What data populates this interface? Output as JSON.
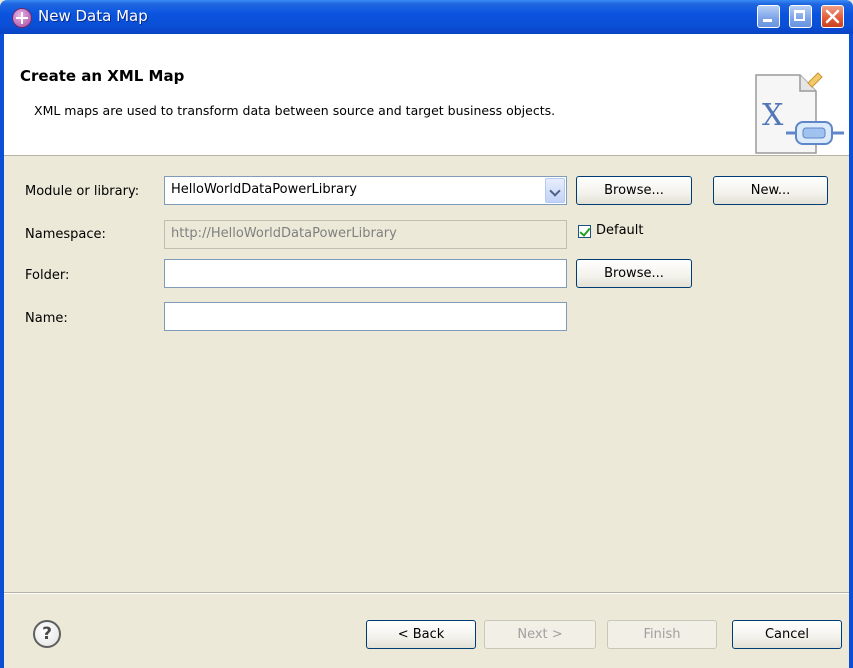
{
  "window": {
    "title": "New Data Map"
  },
  "header": {
    "title": "Create an XML Map",
    "description": "XML maps are used to transform data between source and target business objects.",
    "graphic_letter": "X"
  },
  "form": {
    "module_label": "Module or library:",
    "module_value": "HelloWorldDataPowerLibrary",
    "module_browse_label": "Browse...",
    "module_new_label": "New...",
    "namespace_label": "Namespace:",
    "namespace_value": "http://HelloWorldDataPowerLibrary",
    "default_label": "Default",
    "default_checked": true,
    "folder_label": "Folder:",
    "folder_value": "",
    "folder_browse_label": "Browse...",
    "name_label": "Name:",
    "name_value": ""
  },
  "footer": {
    "help_glyph": "?",
    "back_label": "< Back",
    "next_label": "Next >",
    "finish_label": "Finish",
    "cancel_label": "Cancel"
  },
  "colors": {
    "titlebar": "#0A4FD6",
    "dialog_bg": "#ECE9D8",
    "check_mark": "#21A121"
  }
}
